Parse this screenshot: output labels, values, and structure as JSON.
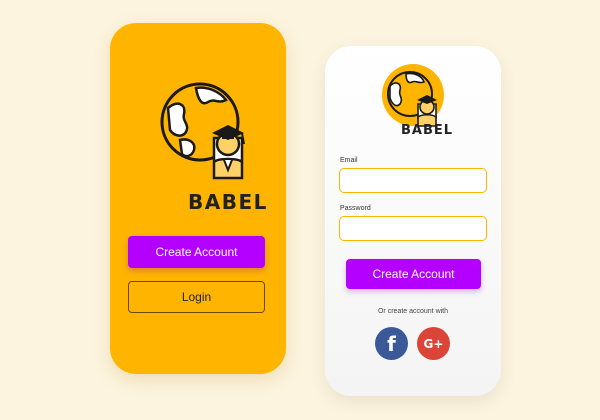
{
  "colors": {
    "background": "#fcf4de",
    "accent_yellow": "#ffb400",
    "primary_button": "#b400ff",
    "facebook": "#3b5998",
    "google": "#db4437"
  },
  "welcome_screen": {
    "brand": "BABEL",
    "logo_icon": "globe-graduate-icon",
    "create_account_label": "Create Account",
    "login_label": "Login"
  },
  "signup_screen": {
    "brand": "BABEL",
    "logo_icon": "globe-graduate-icon",
    "email_label": "Email",
    "email_value": "",
    "password_label": "Password",
    "password_value": "",
    "create_account_label": "Create Account",
    "alt_text": "Or create account with",
    "social": [
      {
        "name": "facebook",
        "icon": "facebook-icon",
        "glyph": "f"
      },
      {
        "name": "google-plus",
        "icon": "google-plus-icon",
        "glyph": "G+"
      }
    ]
  }
}
